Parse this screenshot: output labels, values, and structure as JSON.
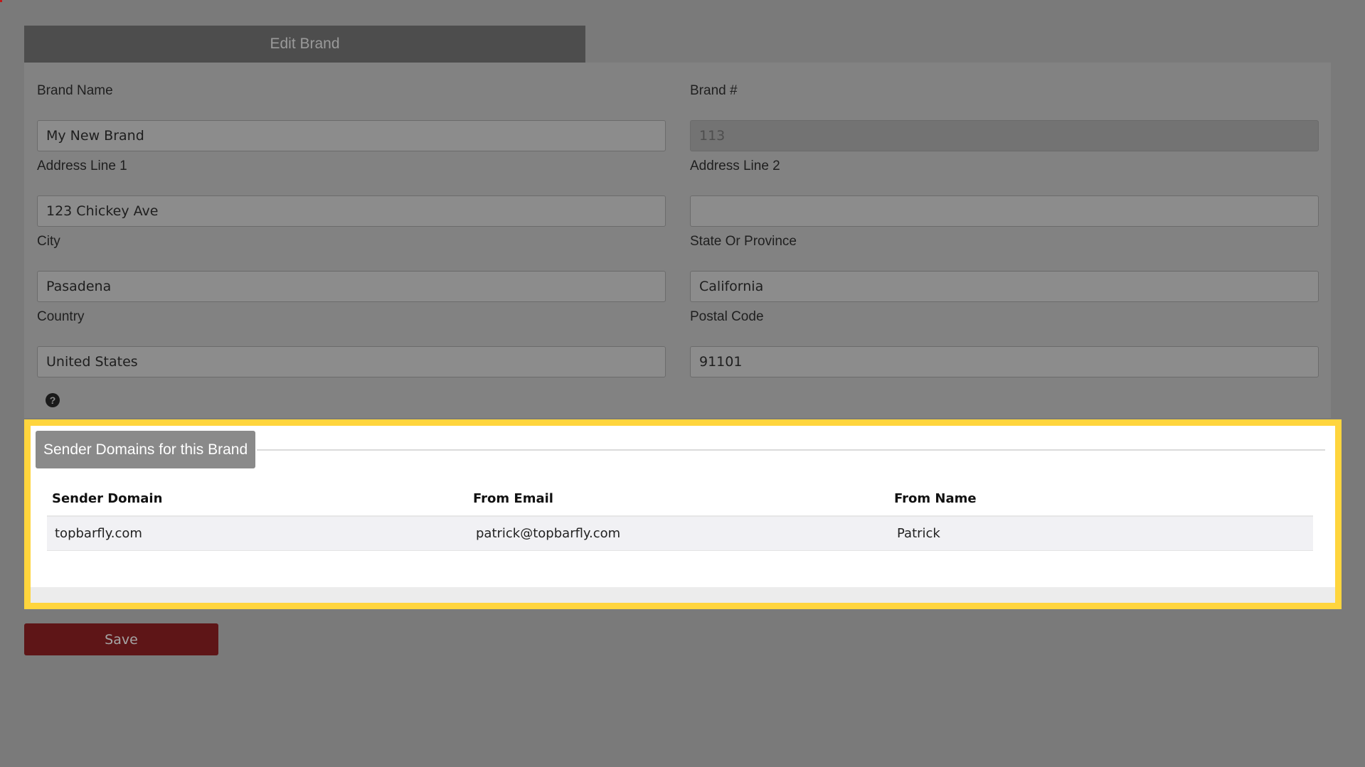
{
  "header": {
    "title": "Edit Brand"
  },
  "form": {
    "brand_name": {
      "label": "Brand Name",
      "value": "My New Brand"
    },
    "brand_number": {
      "label": "Brand #",
      "value": "113"
    },
    "address_line_1": {
      "label": "Address Line 1",
      "value": "123 Chickey Ave"
    },
    "address_line_2": {
      "label": "Address Line 2",
      "value": ""
    },
    "city": {
      "label": "City",
      "value": "Pasadena"
    },
    "state": {
      "label": "State Or Province",
      "value": "California"
    },
    "country": {
      "label": "Country",
      "value": "United States"
    },
    "postal_code": {
      "label": "Postal Code",
      "value": "91101"
    },
    "help_icon": "question-circle-icon"
  },
  "sender_domains": {
    "title": "Sender Domains for this Brand",
    "columns": [
      "Sender Domain",
      "From Email",
      "From Name"
    ],
    "rows": [
      [
        "topbarfly.com",
        "patrick@topbarfly.com",
        "Patrick"
      ]
    ]
  },
  "actions": {
    "save_label": "Save"
  },
  "colors": {
    "highlight_border": "#ffd53d",
    "save_button": "#5e1517",
    "header_bg": "#4d4d4d"
  }
}
